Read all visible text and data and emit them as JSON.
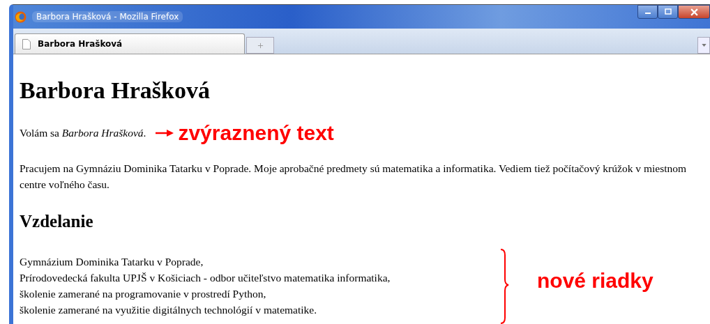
{
  "window": {
    "title": "Barbora Hrašková - Mozilla Firefox"
  },
  "tabs": [
    {
      "label": "Barbora Hrašková",
      "selected": true
    }
  ],
  "page": {
    "heading": "Barbora Hrašková",
    "intro": "Volám sa *Barbora Hrašková*.",
    "paragraph": "Pracujem na Gymnáziu Dominika Tatarku v Poprade. Moje aprobačné predmety sú matematika a informatika. Vediem tiež počítačový krúžok v miestnom centre voľného času.",
    "subheading": "Vzdelanie",
    "education": [
      "Gymnázium Dominika Tatarku v Poprade,",
      "Prírodovedecká fakulta UPJŠ v Košiciach - odbor učiteľstvo matematika informatika,",
      "školenie zamerané na programovanie v prostredí Python,",
      "školenie zamerané na využitie digitálnych technológií v matematike."
    ]
  },
  "annotations": [
    {
      "kind": "arrow",
      "text": "zvýraznený text"
    },
    {
      "kind": "brace",
      "text": "nové riadky"
    }
  ]
}
